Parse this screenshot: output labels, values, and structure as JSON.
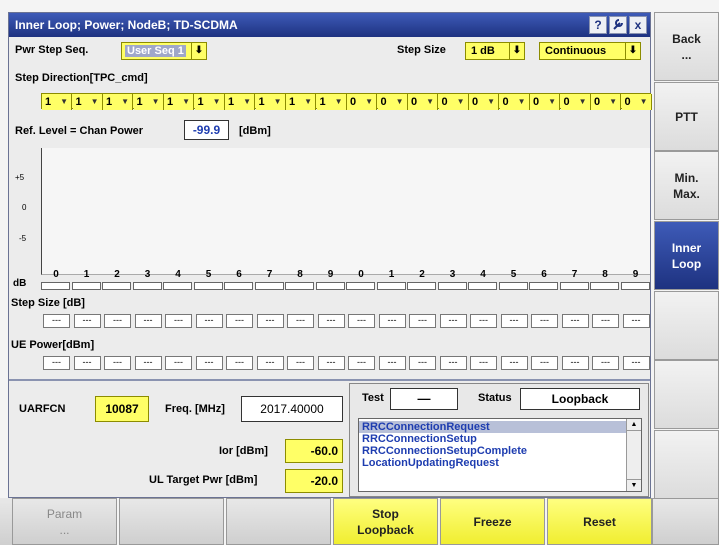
{
  "window": {
    "title": "Inner Loop; Power; NodeB; TD-SCDMA",
    "help_icon": "?",
    "settings_icon": "wrench",
    "close_icon": "x"
  },
  "controls": {
    "pwr_step_seq_label": "Pwr Step Seq.",
    "pwr_step_seq_value": "User Seq 1",
    "step_size_label": "Step Size",
    "step_size_value": "1 dB",
    "mode_value": "Continuous"
  },
  "step_direction": {
    "label": "Step Direction[TPC_cmd]",
    "values": [
      "1",
      "1",
      "1",
      "1",
      "1",
      "1",
      "1",
      "1",
      "1",
      "1",
      "0",
      "0",
      "0",
      "0",
      "0",
      "0",
      "0",
      "0",
      "0",
      "0"
    ]
  },
  "ref_level": {
    "label": "Ref. Level = Chan Power",
    "value": "-99.9",
    "unit": "[dBm]"
  },
  "plot": {
    "yticks": [
      "+5",
      "0",
      "-5"
    ],
    "x_label": "dB",
    "x_indices": [
      "0",
      "1",
      "2",
      "3",
      "4",
      "5",
      "6",
      "7",
      "8",
      "9",
      "0",
      "1",
      "2",
      "3",
      "4",
      "5",
      "6",
      "7",
      "8",
      "9"
    ]
  },
  "step_size_row": {
    "label": "Step Size [dB]",
    "values": [
      "---",
      "---",
      "---",
      "---",
      "---",
      "---",
      "---",
      "---",
      "---",
      "---",
      "---",
      "---",
      "---",
      "---",
      "---",
      "---",
      "---",
      "---",
      "---",
      "---"
    ]
  },
  "ue_power_row": {
    "label": "UE Power[dBm]",
    "values": [
      "---",
      "---",
      "---",
      "---",
      "---",
      "---",
      "---",
      "---",
      "---",
      "---",
      "---",
      "---",
      "---",
      "---",
      "---",
      "---",
      "---",
      "---",
      "---",
      "---"
    ]
  },
  "params": {
    "uarfcn_label": "UARFCN",
    "uarfcn_value": "10087",
    "freq_label": "Freq. [MHz]",
    "freq_value": "2017.40000",
    "ior_label": "Ior [dBm]",
    "ior_value": "-60.0",
    "ul_target_label": "UL Target Pwr [dBm]",
    "ul_target_value": "-20.0"
  },
  "status": {
    "test_label": "Test",
    "test_value": "—",
    "status_label": "Status",
    "status_value": "Loopback",
    "messages": [
      "RRCConnectionRequest",
      "RRCConnectionSetup",
      "RRCConnectionSetupComplete",
      "LocationUpdatingRequest"
    ]
  },
  "softkeys": [
    {
      "line1": "Back",
      "line2": "..."
    },
    {
      "line1": "PTT",
      "line2": ""
    },
    {
      "line1": "Min.",
      "line2": "Max."
    },
    {
      "line1": "Inner",
      "line2": "Loop"
    },
    {
      "line1": "",
      "line2": ""
    },
    {
      "line1": "",
      "line2": ""
    },
    {
      "line1": "",
      "line2": ""
    }
  ],
  "bottom_keys": [
    {
      "line1": "Param",
      "line2": "..."
    },
    {
      "line1": "",
      "line2": ""
    },
    {
      "line1": "",
      "line2": ""
    },
    {
      "line1": "Stop",
      "line2": "Loopback"
    },
    {
      "line1": "Freeze",
      "line2": ""
    },
    {
      "line1": "Reset",
      "line2": ""
    }
  ],
  "colors": {
    "title_bar": "#1e3280",
    "highlight_yellow": "#ffff66",
    "active_softkey": "#1e3280"
  }
}
